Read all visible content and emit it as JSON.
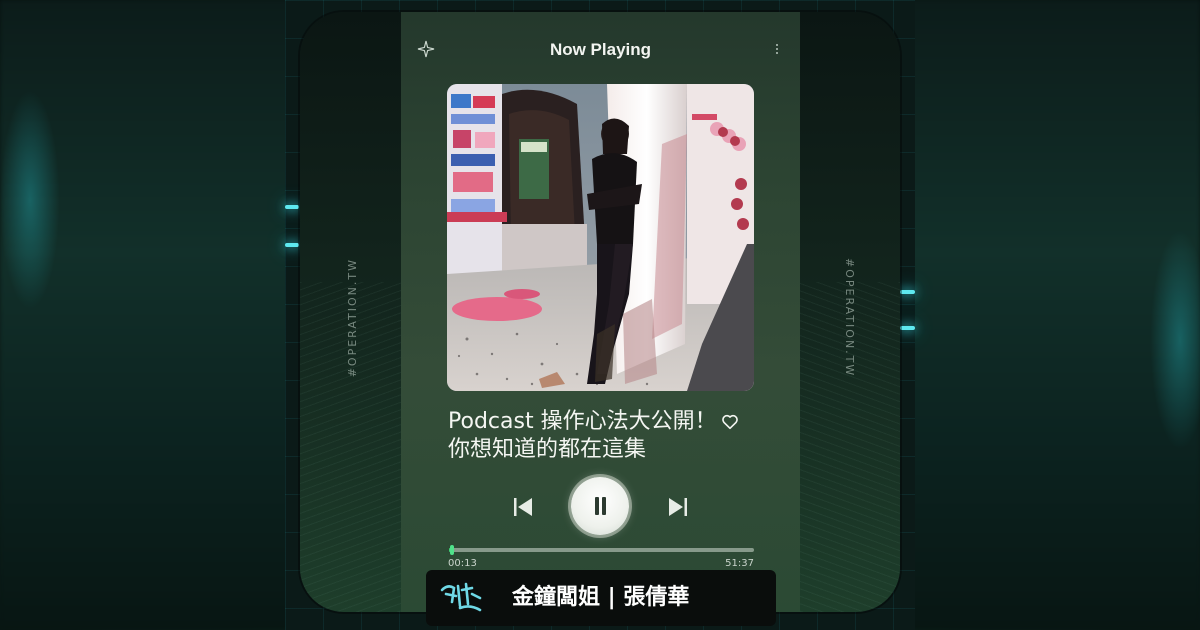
{
  "header": {
    "title": "Now Playing",
    "sparkle_icon": "sparkle-icon",
    "menu_icon": "more-vertical-icon"
  },
  "side_tags": {
    "left": "#OPERATION.TW",
    "right": "#OPERATION.TW"
  },
  "track": {
    "title_line1": "Podcast 操作心法大公開！",
    "title_line2": "你想知道的都在這集",
    "liked": true,
    "heart_icon": "heart-outline-icon"
  },
  "controls": {
    "prev_icon": "skip-previous-icon",
    "play_state": "playing",
    "pause_icon": "pause-icon",
    "next_icon": "skip-next-icon"
  },
  "progress": {
    "current": "00:13",
    "duration": "51:37",
    "fraction": 0.0042
  },
  "banner": {
    "logo_text": "好牛一下",
    "name": "金鐘闆姐 | 張倩華"
  },
  "colors": {
    "accent": "#3ecf76",
    "neon": "#5ee8f0",
    "card_bg": "#2d4533",
    "banner_bg": "#0a0d0c"
  }
}
